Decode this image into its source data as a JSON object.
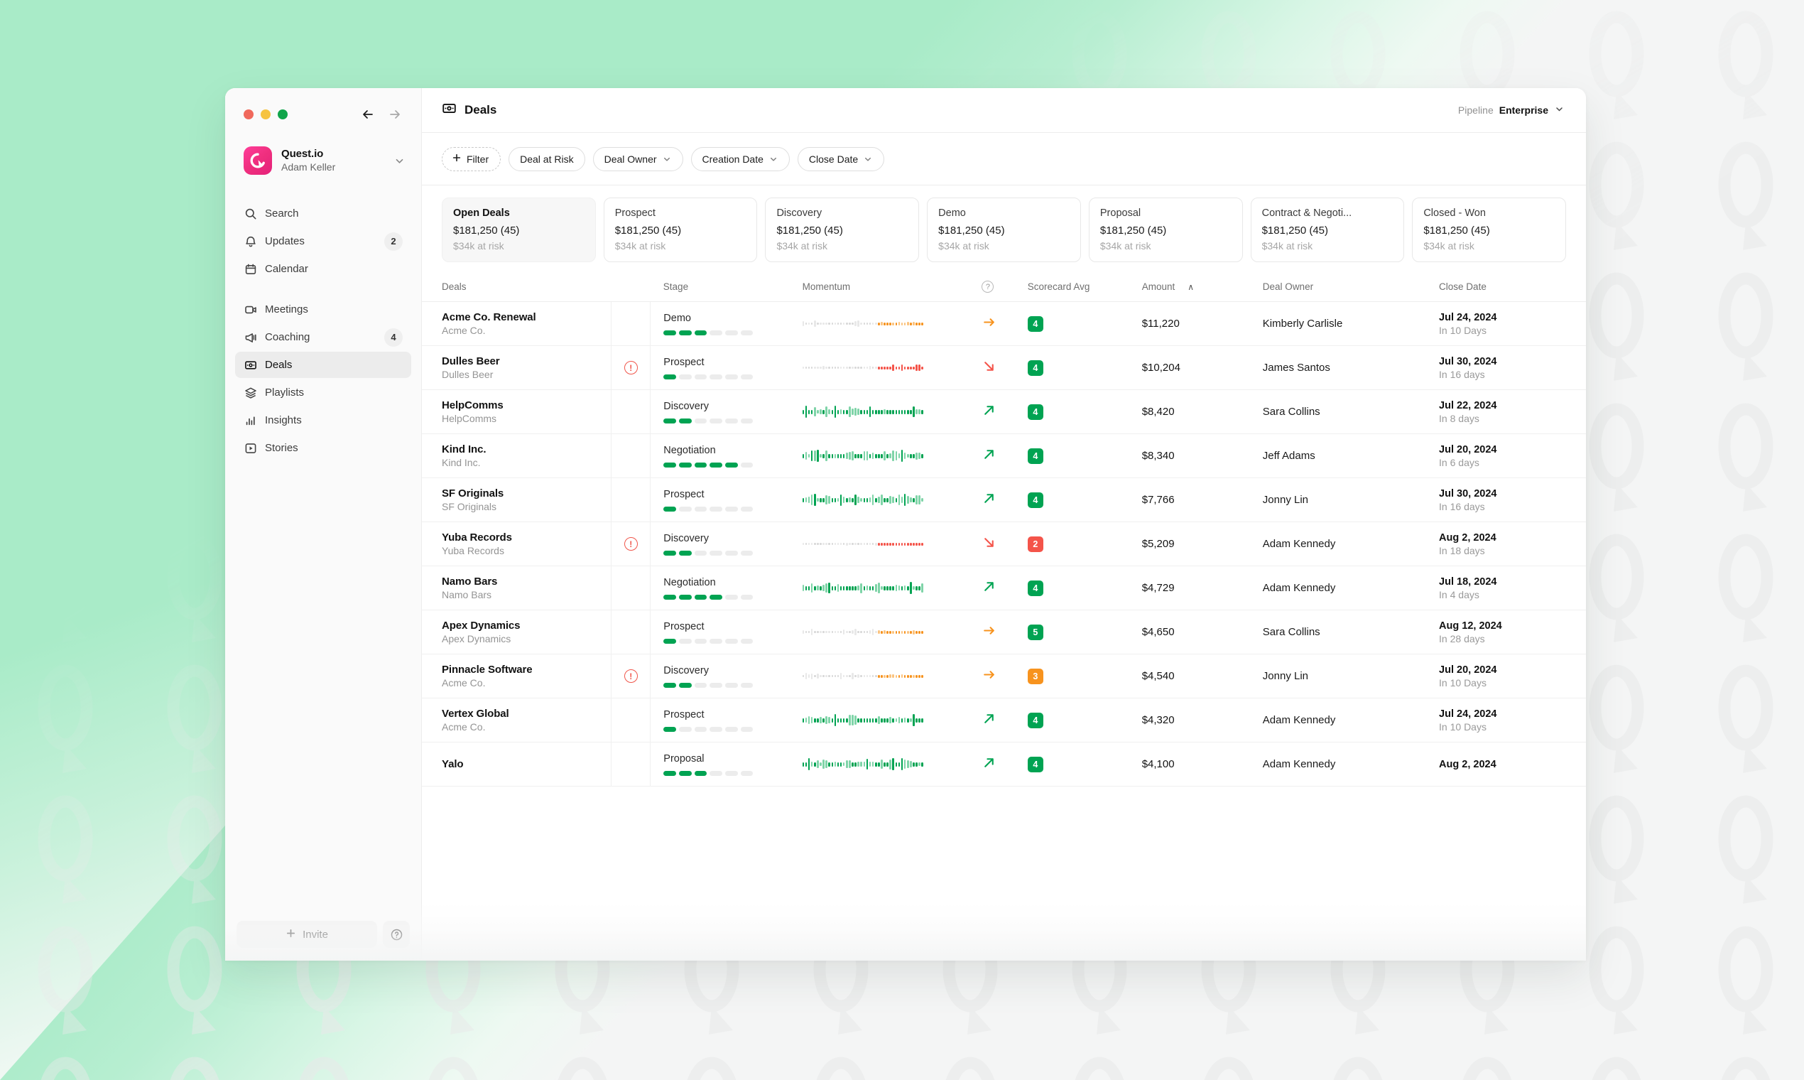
{
  "window": {
    "traffic_lights": [
      "close",
      "minimize",
      "maximize"
    ],
    "nav_back": "back-arrow",
    "nav_forward": "forward-arrow"
  },
  "sidebar": {
    "workspace": {
      "name": "Quest.io",
      "user": "Adam Keller",
      "logo_colors": [
        "#ff3d9a",
        "#e5217a"
      ]
    },
    "items": [
      {
        "label": "Search",
        "icon": "search-icon",
        "badge": "",
        "active": false
      },
      {
        "label": "Updates",
        "icon": "bell-icon",
        "badge": "2",
        "active": false
      },
      {
        "label": "Calendar",
        "icon": "calendar-icon",
        "badge": "",
        "active": false
      },
      {
        "label": "Meetings",
        "icon": "video-icon",
        "badge": "",
        "active": false
      },
      {
        "label": "Coaching",
        "icon": "megaphone-icon",
        "badge": "4",
        "active": false
      },
      {
        "label": "Deals",
        "icon": "money-icon",
        "badge": "",
        "active": true
      },
      {
        "label": "Playlists",
        "icon": "layers-icon",
        "badge": "",
        "active": false
      },
      {
        "label": "Insights",
        "icon": "bar-chart-icon",
        "badge": "",
        "active": false
      },
      {
        "label": "Stories",
        "icon": "play-box-icon",
        "badge": "",
        "active": false
      }
    ],
    "invite_label": "Invite",
    "help_label": "?"
  },
  "header": {
    "title": "Deals",
    "title_icon": "money-icon",
    "pipeline_label": "Pipeline",
    "pipeline_value": "Enterprise"
  },
  "filters": [
    {
      "label": "Filter",
      "type": "add",
      "icon": "plus-icon"
    },
    {
      "label": "Deal at Risk",
      "type": "plain",
      "icon": ""
    },
    {
      "label": "Deal Owner",
      "type": "dropdown",
      "icon": "chevron-down-icon"
    },
    {
      "label": "Creation Date",
      "type": "dropdown",
      "icon": "chevron-down-icon"
    },
    {
      "label": "Close Date",
      "type": "dropdown",
      "icon": "chevron-down-icon"
    }
  ],
  "stage_cards": [
    {
      "name": "Open Deals",
      "amount": "$181,250 (45)",
      "risk": "$34k at risk",
      "active": true
    },
    {
      "name": "Prospect",
      "amount": "$181,250 (45)",
      "risk": "$34k at risk",
      "active": false
    },
    {
      "name": "Discovery",
      "amount": "$181,250 (45)",
      "risk": "$34k at risk",
      "active": false
    },
    {
      "name": "Demo",
      "amount": "$181,250 (45)",
      "risk": "$34k at risk",
      "active": false
    },
    {
      "name": "Proposal",
      "amount": "$181,250 (45)",
      "risk": "$34k at risk",
      "active": false
    },
    {
      "name": "Contract & Negoti...",
      "amount": "$181,250 (45)",
      "risk": "$34k at risk",
      "active": false
    },
    {
      "name": "Closed - Won",
      "amount": "$181,250 (45)",
      "risk": "$34k at risk",
      "active": false
    }
  ],
  "table": {
    "columns": {
      "deals": "Deals",
      "stage": "Stage",
      "momentum": "Momentum",
      "momentum_help": "?",
      "scorecard": "Scorecard Avg",
      "amount": "Amount",
      "amount_sort": "∧",
      "owner": "Deal Owner",
      "close": "Close Date"
    },
    "colors": {
      "green": "#00a352",
      "green_light": "#7fd4a8",
      "orange": "#f7931e",
      "orange_light": "#fbc37e",
      "red": "#f4544a",
      "grey": "#d8d8d8",
      "grey_light": "#e8e8e8"
    },
    "rows": [
      {
        "name": "Acme Co. Renewal",
        "company": "Acme Co.",
        "at_risk": false,
        "stage": "Demo",
        "stage_step": 3,
        "stage_total": 6,
        "momentum": "orange",
        "trend": "flat",
        "score": "4",
        "score_color": "#00a352",
        "amount": "$11,220",
        "owner": "Kimberly Carlisle",
        "close_date": "Jul 24, 2024",
        "close_rel": "In 10 Days"
      },
      {
        "name": "Dulles Beer",
        "company": "Dulles Beer",
        "at_risk": true,
        "stage": "Prospect",
        "stage_step": 1,
        "stage_total": 6,
        "momentum": "red",
        "trend": "down",
        "score": "4",
        "score_color": "#00a352",
        "amount": "$10,204",
        "owner": "James Santos",
        "close_date": "Jul 30, 2024",
        "close_rel": "In 16 days"
      },
      {
        "name": "HelpComms",
        "company": "HelpComms",
        "at_risk": false,
        "stage": "Discovery",
        "stage_step": 2,
        "stage_total": 6,
        "momentum": "green",
        "trend": "up",
        "score": "4",
        "score_color": "#00a352",
        "amount": "$8,420",
        "owner": "Sara Collins",
        "close_date": "Jul 22, 2024",
        "close_rel": "In 8 days"
      },
      {
        "name": "Kind Inc.",
        "company": "Kind Inc.",
        "at_risk": false,
        "stage": "Negotiation",
        "stage_step": 5,
        "stage_total": 6,
        "momentum": "green",
        "trend": "up",
        "score": "4",
        "score_color": "#00a352",
        "amount": "$8,340",
        "owner": "Jeff Adams",
        "close_date": "Jul 20, 2024",
        "close_rel": "In 6 days"
      },
      {
        "name": "SF Originals",
        "company": "SF Originals",
        "at_risk": false,
        "stage": "Prospect",
        "stage_step": 1,
        "stage_total": 6,
        "momentum": "green",
        "trend": "up",
        "score": "4",
        "score_color": "#00a352",
        "amount": "$7,766",
        "owner": "Jonny Lin",
        "close_date": "Jul 30, 2024",
        "close_rel": "In 16 days"
      },
      {
        "name": "Yuba Records",
        "company": "Yuba Records",
        "at_risk": true,
        "stage": "Discovery",
        "stage_step": 2,
        "stage_total": 6,
        "momentum": "red",
        "trend": "down",
        "score": "2",
        "score_color": "#f4544a",
        "amount": "$5,209",
        "owner": "Adam Kennedy",
        "close_date": "Aug 2, 2024",
        "close_rel": "In 18 days"
      },
      {
        "name": "Namo Bars",
        "company": "Namo Bars",
        "at_risk": false,
        "stage": "Negotiation",
        "stage_step": 4,
        "stage_total": 6,
        "momentum": "green",
        "trend": "up",
        "score": "4",
        "score_color": "#00a352",
        "amount": "$4,729",
        "owner": "Adam Kennedy",
        "close_date": "Jul 18, 2024",
        "close_rel": "In 4 days"
      },
      {
        "name": "Apex Dynamics",
        "company": "Apex Dynamics",
        "at_risk": false,
        "stage": "Prospect",
        "stage_step": 1,
        "stage_total": 6,
        "momentum": "orange",
        "trend": "flat",
        "score": "5",
        "score_color": "#00a352",
        "amount": "$4,650",
        "owner": "Sara Collins",
        "close_date": "Aug 12, 2024",
        "close_rel": "In 28 days"
      },
      {
        "name": "Pinnacle Software",
        "company": "Acme Co.",
        "at_risk": true,
        "stage": "Discovery",
        "stage_step": 2,
        "stage_total": 6,
        "momentum": "orange",
        "trend": "flat",
        "score": "3",
        "score_color": "#f7931e",
        "amount": "$4,540",
        "owner": "Jonny Lin",
        "close_date": "Jul 20, 2024",
        "close_rel": "In 10 Days"
      },
      {
        "name": "Vertex Global",
        "company": "Acme Co.",
        "at_risk": false,
        "stage": "Prospect",
        "stage_step": 1,
        "stage_total": 6,
        "momentum": "green",
        "trend": "up",
        "score": "4",
        "score_color": "#00a352",
        "amount": "$4,320",
        "owner": "Adam Kennedy",
        "close_date": "Jul 24, 2024",
        "close_rel": "In 10 Days"
      },
      {
        "name": "Yalo",
        "company": "",
        "at_risk": false,
        "stage": "Proposal",
        "stage_step": 3,
        "stage_total": 6,
        "momentum": "green",
        "trend": "up",
        "score": "4",
        "score_color": "#00a352",
        "amount": "$4,100",
        "owner": "Adam Kennedy",
        "close_date": "Aug 2, 2024",
        "close_rel": ""
      }
    ]
  }
}
